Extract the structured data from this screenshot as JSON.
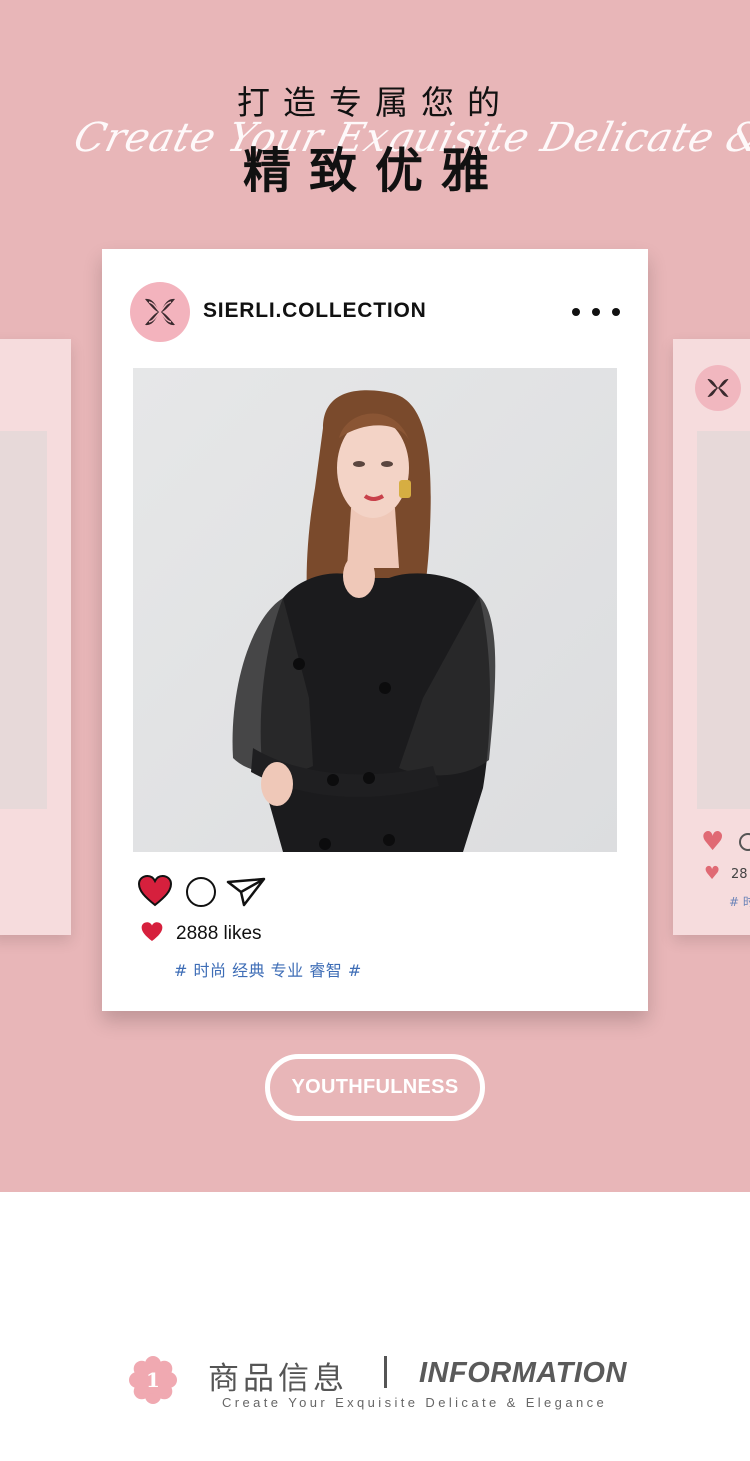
{
  "header": {
    "script_text": "Create Your Exquisite Delicate & Elegance",
    "title_line1": "打造专属您的",
    "title_line2": "精致优雅"
  },
  "post": {
    "account_name": "SIERLI.COLLECTION",
    "more_icon": "more-dots-icon",
    "likes_text": "2888 likes",
    "hashtags": "# 时尚 经典 专业 睿智 #",
    "icons": [
      "heart-icon",
      "comment-icon",
      "send-icon"
    ],
    "heart_color": "#d6203d"
  },
  "side_right": {
    "likes_text": "28",
    "tag_text": "# 时"
  },
  "badge": {
    "label": "YOUTHFULNESS"
  },
  "section": {
    "number": "1",
    "title_cn": "商品信息",
    "title_en": "INFORMATION",
    "subtitle": "Create Your Exquisite Delicate & Elegance"
  },
  "colors": {
    "background_pink": "#e8b6b8",
    "side_card": "#f6dcdd",
    "hashtag_blue": "#3e6db6",
    "flower": "#f0a9b1"
  }
}
